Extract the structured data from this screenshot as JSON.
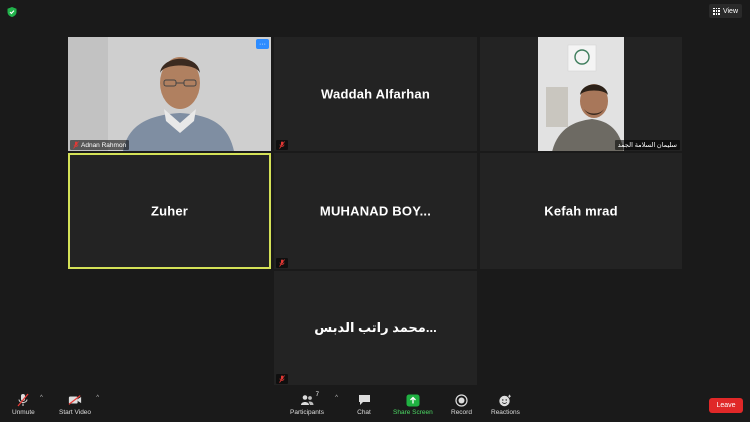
{
  "top": {
    "view_label": "View"
  },
  "tiles": {
    "adnan": {
      "label": "Adnan Rahmon",
      "more": "···"
    },
    "waddah": {
      "name": "Waddah Alfarhan"
    },
    "suleiman": {
      "label": "سليمان السلامة الجمد"
    },
    "zuher": {
      "name": "Zuher"
    },
    "muhanad": {
      "name": "MUHANAD  BOY..."
    },
    "kefah": {
      "name": "Kefah mrad"
    },
    "mohammad": {
      "name": "...محمد راتب الدبس"
    }
  },
  "toolbar": {
    "unmute": "Unmute",
    "start_video": "Start Video",
    "participants": "Participants",
    "participants_count": "7",
    "chat": "Chat",
    "share_screen": "Share Screen",
    "record": "Record",
    "reactions": "Reactions",
    "leave": "Leave"
  },
  "colors": {
    "active_speaker": "#d4e157",
    "leave": "#e02828",
    "share": "#4cd964",
    "accent": "#2d8cff"
  }
}
